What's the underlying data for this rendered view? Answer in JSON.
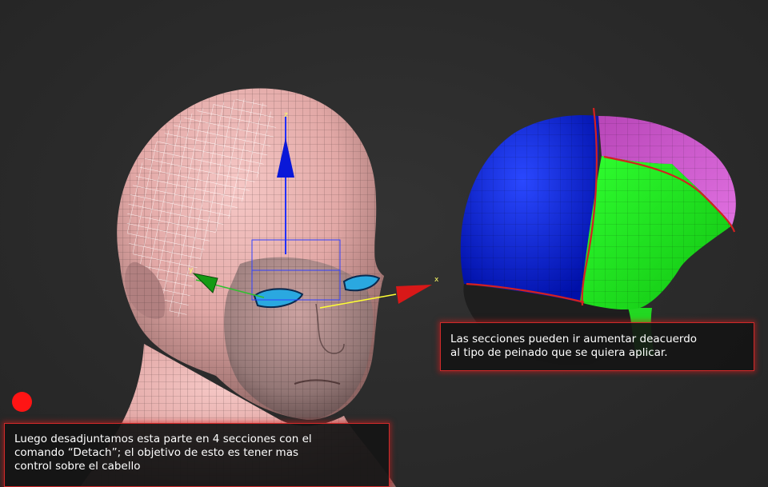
{
  "captions": {
    "right": {
      "line1": "Las secciones pueden ir aumentar deacuerdo",
      "line2": "al tipo de peinado que se quiera aplicar."
    },
    "left": {
      "line1": "Luego desadjuntamos esta parte en 4 secciones con el",
      "line2": "comando “Detach”; el objetivo de esto es tener mas",
      "line3": "control sobre el cabello"
    }
  },
  "gizmo": {
    "x_label": "x",
    "z_label": "z",
    "y_label": "y"
  },
  "colors": {
    "background": "#2b2b2b",
    "head_skin": "#e8b4b2",
    "section_blue": "#0a1fd6",
    "section_magenta": "#c64cc6",
    "section_green": "#19f019",
    "outline_red": "#d42020",
    "record_dot": "#ff1414"
  }
}
